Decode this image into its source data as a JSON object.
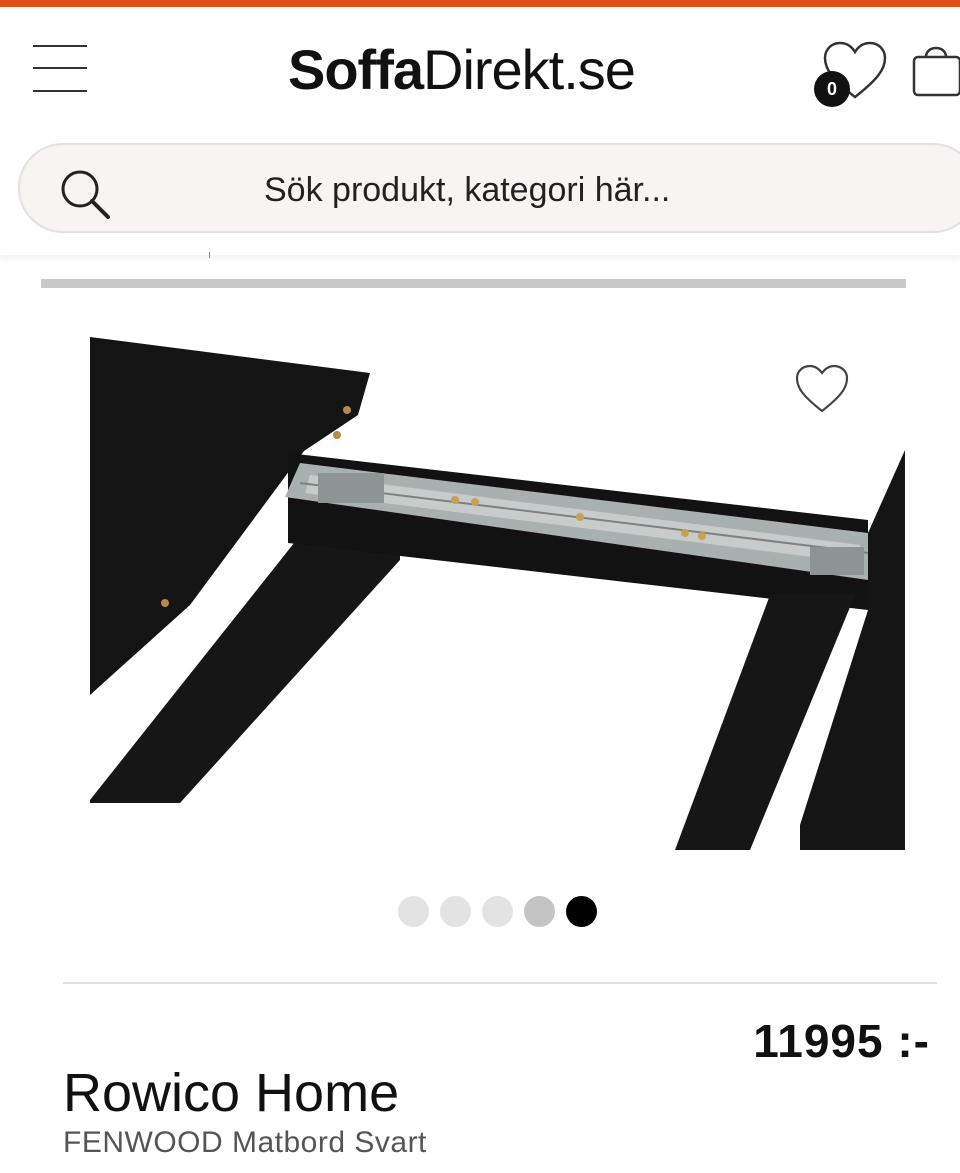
{
  "colors": {
    "accent": "#e04e1a",
    "text": "#111111",
    "search_bg": "#f7f5f2",
    "product_black": "#131313"
  },
  "header": {
    "logo_bold": "Soffa",
    "logo_regular": "Direkt.se",
    "wishlist_count": "0",
    "icons": [
      "menu-icon",
      "heart-icon",
      "cart-icon"
    ]
  },
  "search": {
    "placeholder": "Sök produkt, kategori här...",
    "icon": "search-icon"
  },
  "gallery": {
    "image_alt": "FENWOOD Matbord Svart – utdragsmekanism",
    "slide_count": 5,
    "active_slide": 5,
    "favorite_icon": "heart-outline-icon"
  },
  "product": {
    "price": "11995 :-",
    "brand": "Rowico Home",
    "name": "FENWOOD Matbord Svart"
  }
}
